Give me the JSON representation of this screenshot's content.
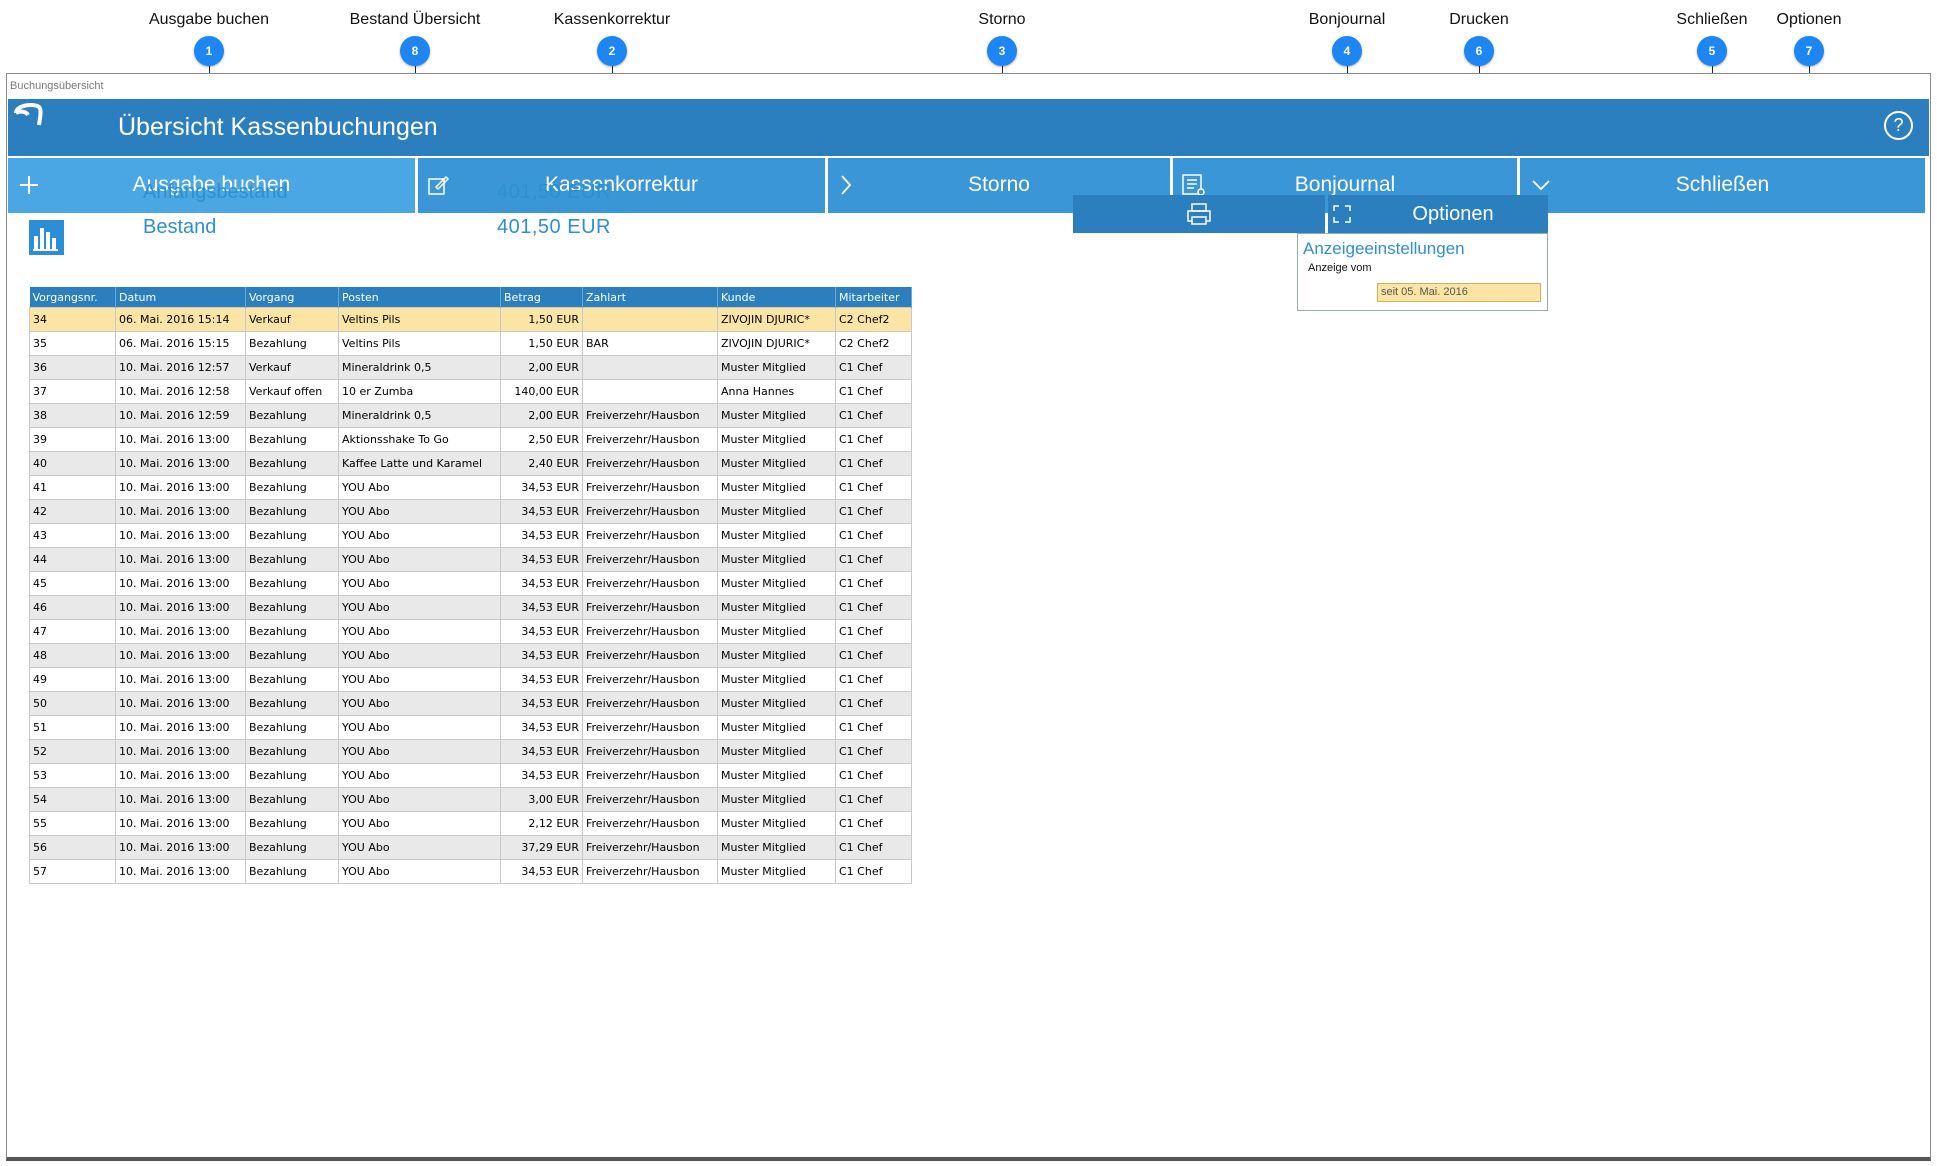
{
  "callouts": [
    {
      "label": "Ausgabe buchen",
      "num": "1"
    },
    {
      "label": "Bestand Übersicht",
      "num": "8"
    },
    {
      "label": "Kassenkorrektur",
      "num": "2"
    },
    {
      "label": "Storno",
      "num": "3"
    },
    {
      "label": "Bonjournal",
      "num": "4"
    },
    {
      "label": "Drucken",
      "num": "6"
    },
    {
      "label": "Schließen",
      "num": "5"
    },
    {
      "label": "Optionen",
      "num": "7"
    }
  ],
  "window": {
    "title": "Buchungsübersicht"
  },
  "header": {
    "title": "Übersicht Kassenbuchungen",
    "help": "?"
  },
  "toolbar": {
    "ausgabe": "Ausgabe buchen",
    "korrektur": "Kassenkorrektur",
    "storno": "Storno",
    "bonjournal": "Bonjournal",
    "schliessen": "Schließen"
  },
  "stats": {
    "anfang_label": "Anfangsbestand",
    "anfang_value": "401,50 EUR",
    "bestand_label": "Bestand",
    "bestand_value": "401,50 EUR"
  },
  "options": {
    "button": "Optionen",
    "panel_title": "Anzeigeeinstellungen",
    "anzeige_label": "Anzeige vom",
    "anzeige_value": "seit 05. Mai. 2016"
  },
  "table": {
    "columns": [
      "Vorgangsnr.",
      "Datum",
      "Vorgang",
      "Posten",
      "Betrag",
      "Zahlart",
      "Kunde",
      "Mitarbeiter"
    ],
    "rows": [
      [
        "34",
        "06. Mai. 2016 15:14",
        "Verkauf",
        "Veltins Pils",
        "1,50 EUR",
        "",
        "ZIVOJIN DJURIC*",
        "C2 Chef2"
      ],
      [
        "35",
        "06. Mai. 2016 15:15",
        "Bezahlung",
        "Veltins Pils",
        "1,50 EUR",
        "BAR",
        "ZIVOJIN DJURIC*",
        "C2 Chef2"
      ],
      [
        "36",
        "10. Mai. 2016 12:57",
        "Verkauf",
        "Mineraldrink 0,5",
        "2,00 EUR",
        "",
        "Muster Mitglied",
        "C1 Chef"
      ],
      [
        "37",
        "10. Mai. 2016 12:58",
        "Verkauf offen",
        "10 er Zumba",
        "140,00 EUR",
        "",
        "Anna Hannes",
        "C1 Chef"
      ],
      [
        "38",
        "10. Mai. 2016 12:59",
        "Bezahlung",
        "Mineraldrink 0,5",
        "2,00 EUR",
        "Freiverzehr/Hausbon",
        "Muster Mitglied",
        "C1 Chef"
      ],
      [
        "39",
        "10. Mai. 2016 13:00",
        "Bezahlung",
        "Aktionsshake To Go",
        "2,50 EUR",
        "Freiverzehr/Hausbon",
        "Muster Mitglied",
        "C1 Chef"
      ],
      [
        "40",
        "10. Mai. 2016 13:00",
        "Bezahlung",
        "Kaffee Latte und Karamel",
        "2,40 EUR",
        "Freiverzehr/Hausbon",
        "Muster Mitglied",
        "C1 Chef"
      ],
      [
        "41",
        "10. Mai. 2016 13:00",
        "Bezahlung",
        "YOU Abo",
        "34,53 EUR",
        "Freiverzehr/Hausbon",
        "Muster Mitglied",
        "C1 Chef"
      ],
      [
        "42",
        "10. Mai. 2016 13:00",
        "Bezahlung",
        "YOU Abo",
        "34,53 EUR",
        "Freiverzehr/Hausbon",
        "Muster Mitglied",
        "C1 Chef"
      ],
      [
        "43",
        "10. Mai. 2016 13:00",
        "Bezahlung",
        "YOU Abo",
        "34,53 EUR",
        "Freiverzehr/Hausbon",
        "Muster Mitglied",
        "C1 Chef"
      ],
      [
        "44",
        "10. Mai. 2016 13:00",
        "Bezahlung",
        "YOU Abo",
        "34,53 EUR",
        "Freiverzehr/Hausbon",
        "Muster Mitglied",
        "C1 Chef"
      ],
      [
        "45",
        "10. Mai. 2016 13:00",
        "Bezahlung",
        "YOU Abo",
        "34,53 EUR",
        "Freiverzehr/Hausbon",
        "Muster Mitglied",
        "C1 Chef"
      ],
      [
        "46",
        "10. Mai. 2016 13:00",
        "Bezahlung",
        "YOU Abo",
        "34,53 EUR",
        "Freiverzehr/Hausbon",
        "Muster Mitglied",
        "C1 Chef"
      ],
      [
        "47",
        "10. Mai. 2016 13:00",
        "Bezahlung",
        "YOU Abo",
        "34,53 EUR",
        "Freiverzehr/Hausbon",
        "Muster Mitglied",
        "C1 Chef"
      ],
      [
        "48",
        "10. Mai. 2016 13:00",
        "Bezahlung",
        "YOU Abo",
        "34,53 EUR",
        "Freiverzehr/Hausbon",
        "Muster Mitglied",
        "C1 Chef"
      ],
      [
        "49",
        "10. Mai. 2016 13:00",
        "Bezahlung",
        "YOU Abo",
        "34,53 EUR",
        "Freiverzehr/Hausbon",
        "Muster Mitglied",
        "C1 Chef"
      ],
      [
        "50",
        "10. Mai. 2016 13:00",
        "Bezahlung",
        "YOU Abo",
        "34,53 EUR",
        "Freiverzehr/Hausbon",
        "Muster Mitglied",
        "C1 Chef"
      ],
      [
        "51",
        "10. Mai. 2016 13:00",
        "Bezahlung",
        "YOU Abo",
        "34,53 EUR",
        "Freiverzehr/Hausbon",
        "Muster Mitglied",
        "C1 Chef"
      ],
      [
        "52",
        "10. Mai. 2016 13:00",
        "Bezahlung",
        "YOU Abo",
        "34,53 EUR",
        "Freiverzehr/Hausbon",
        "Muster Mitglied",
        "C1 Chef"
      ],
      [
        "53",
        "10. Mai. 2016 13:00",
        "Bezahlung",
        "YOU Abo",
        "34,53 EUR",
        "Freiverzehr/Hausbon",
        "Muster Mitglied",
        "C1 Chef"
      ],
      [
        "54",
        "10. Mai. 2016 13:00",
        "Bezahlung",
        "YOU Abo",
        "3,00 EUR",
        "Freiverzehr/Hausbon",
        "Muster Mitglied",
        "C1 Chef"
      ],
      [
        "55",
        "10. Mai. 2016 13:00",
        "Bezahlung",
        "YOU Abo",
        "2,12 EUR",
        "Freiverzehr/Hausbon",
        "Muster Mitglied",
        "C1 Chef"
      ],
      [
        "56",
        "10. Mai. 2016 13:00",
        "Bezahlung",
        "YOU Abo",
        "37,29 EUR",
        "Freiverzehr/Hausbon",
        "Muster Mitglied",
        "C1 Chef"
      ],
      [
        "57",
        "10. Mai. 2016 13:00",
        "Bezahlung",
        "YOU Abo",
        "34,53 EUR",
        "Freiverzehr/Hausbon",
        "Muster Mitglied",
        "C1 Chef"
      ]
    ]
  },
  "colors": {
    "header": "#2c7fbf",
    "toolbar": "#3a96d6",
    "selected_row": "#fbe4a4",
    "badge": "#1e86f2"
  }
}
